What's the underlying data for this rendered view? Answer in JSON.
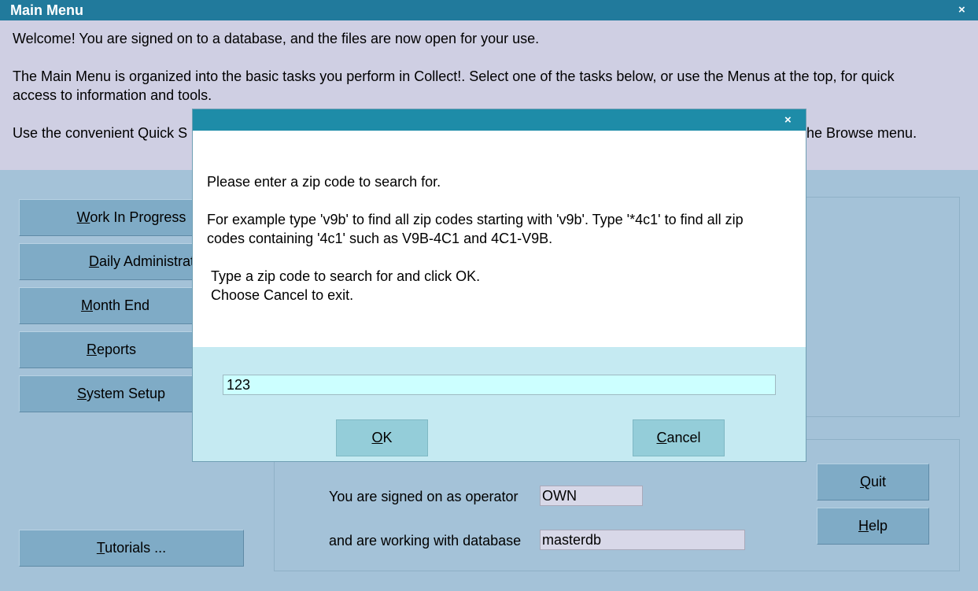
{
  "window": {
    "title": "Main Menu"
  },
  "welcome": {
    "line1": "Welcome! You are signed on to a database, and the files are now open for your use.",
    "line2a": "The Main Menu is organized into the basic tasks you perform in Collect!. Select one of the tasks below, or use the Menus at the top, for quick",
    "line2b": "access to information and tools.",
    "line3_start": "Use the convenient Quick S",
    "line3_end": "he Browse menu."
  },
  "tasks": [
    {
      "pre": "",
      "key": "W",
      "rest": "ork In Progress"
    },
    {
      "pre": "",
      "key": "D",
      "rest": "aily Administration"
    },
    {
      "pre": "",
      "key": "M",
      "rest": "onth End"
    },
    {
      "pre": "",
      "key": "R",
      "rest": "eports"
    },
    {
      "pre": "",
      "key": "S",
      "rest": "ystem Setup"
    }
  ],
  "tutorials": {
    "key": "T",
    "rest": "utorials ..."
  },
  "status": {
    "operator_label": "You are signed on as operator",
    "operator_value": "OWN",
    "database_label": "and are working with database",
    "database_value": "masterdb"
  },
  "side_buttons": {
    "quit": {
      "key": "Q",
      "rest": "uit"
    },
    "help": {
      "key": "H",
      "rest": "elp"
    }
  },
  "dialog": {
    "message_1": "Please enter a zip code to search for.",
    "message_2a": "For example type 'v9b' to find all zip codes starting with 'v9b'. Type '*4c1' to find all zip",
    "message_2b": "codes containing '4c1' such as V9B-4C1 and 4C1-V9B.",
    "message_3a": "Type a zip code to search for and click OK.",
    "message_3b": "Choose Cancel to exit.",
    "input_value": "123",
    "ok": {
      "key": "O",
      "rest": "K"
    },
    "cancel": {
      "key": "C",
      "rest": "ancel"
    }
  },
  "icons": {
    "close": "×"
  },
  "colors": {
    "titlebar": "#217a9c",
    "dialog_titlebar": "#1e8ca8",
    "background": "#a4c2d8",
    "welcome_panel": "#cfcfe3",
    "dialog_body": "#c5eaf2",
    "input": "#ccffff"
  }
}
